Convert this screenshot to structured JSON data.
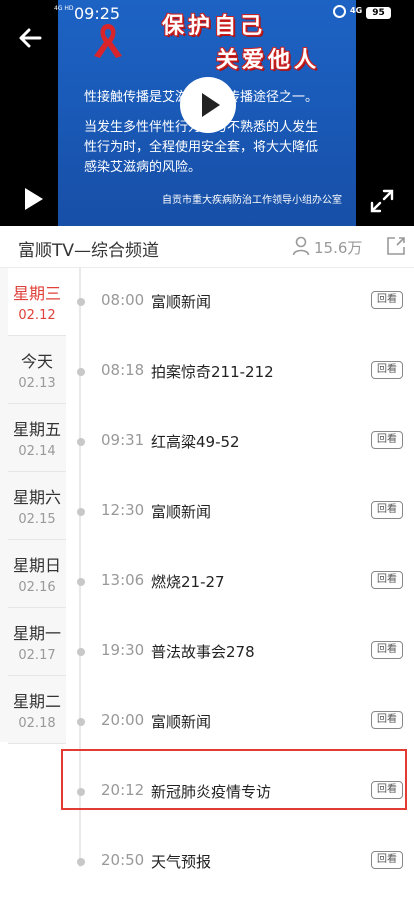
{
  "status_bar": {
    "network": "4G HD",
    "time": "09:25",
    "signal": "4G",
    "battery": "95"
  },
  "video": {
    "title_line1": "保护自己",
    "title_line2": "关爱他人",
    "line1": "性接触传播是艾滋病重要传播途径之一。",
    "line2": "当发生多性伴性行为或与不熟悉的人发生",
    "line3": "性行为时，全程使用安全套，将大大降低",
    "line4": "感染艾滋病的风险。",
    "credit": "自贡市重大疾病防治工作领导小组办公室",
    "icons": [
      "back-arrow-icon",
      "play-icon",
      "fullscreen-icon"
    ]
  },
  "channel": {
    "name": "富顺TV—综合频道",
    "viewers": "15.6万"
  },
  "days": [
    {
      "name": "星期三",
      "date": "02.12",
      "selected": true
    },
    {
      "name": "今天",
      "date": "02.13"
    },
    {
      "name": "星期五",
      "date": "02.14"
    },
    {
      "name": "星期六",
      "date": "02.15"
    },
    {
      "name": "星期日",
      "date": "02.16"
    },
    {
      "name": "星期一",
      "date": "02.17"
    },
    {
      "name": "星期二",
      "date": "02.18"
    }
  ],
  "programs": [
    {
      "time": "08:00",
      "title": "富顺新闻",
      "action": "回看"
    },
    {
      "time": "08:18",
      "title": "拍案惊奇211-212",
      "action": "回看"
    },
    {
      "time": "09:31",
      "title": "红高粱49-52",
      "action": "回看"
    },
    {
      "time": "12:30",
      "title": "富顺新闻",
      "action": "回看"
    },
    {
      "time": "13:06",
      "title": "燃烧21-27",
      "action": "回看"
    },
    {
      "time": "19:30",
      "title": "普法故事会278",
      "action": "回看"
    },
    {
      "time": "20:00",
      "title": "富顺新闻",
      "action": "回看"
    },
    {
      "time": "20:12",
      "title": "新冠肺炎疫情专访",
      "action": "回看",
      "highlighted": true
    },
    {
      "time": "20:50",
      "title": "天气预报",
      "action": "回看"
    }
  ],
  "colors": {
    "accent": "#e0413a",
    "highlight_border": "#e23b33",
    "video_bg": "#1a5ab8"
  }
}
